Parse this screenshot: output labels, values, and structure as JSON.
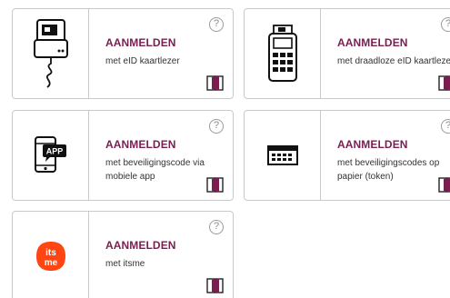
{
  "colors": {
    "accent": "#7a1e4f",
    "border": "#c9c9c9",
    "text": "#333333",
    "itsme": "#ff4612"
  },
  "cards": [
    {
      "title": "AANMELDEN",
      "subtitle": "met eID kaartlezer",
      "help": "?",
      "icon": "eid-card-reader-icon"
    },
    {
      "title": "AANMELDEN",
      "subtitle": "met draadloze eID kaartlezer",
      "help": "?",
      "icon": "wireless-card-reader-icon"
    },
    {
      "title": "AANMELDEN",
      "subtitle": "met beveiligingscode via mobiele app",
      "help": "?",
      "icon": "mobile-app-icon",
      "icon_text": "APP"
    },
    {
      "title": "AANMELDEN",
      "subtitle": "met beveiligingscodes op papier (token)",
      "help": "?",
      "icon": "paper-token-icon"
    },
    {
      "title": "AANMELDEN",
      "subtitle": "met itsme",
      "help": "?",
      "icon": "itsme-logo-icon",
      "icon_text": "its me"
    }
  ]
}
